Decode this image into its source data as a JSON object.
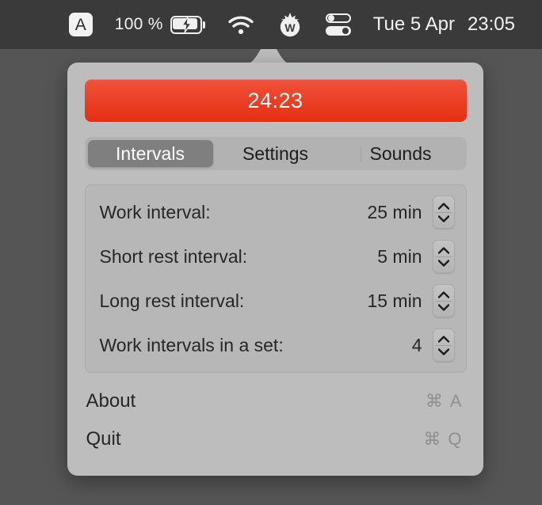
{
  "menubar": {
    "input_source": {
      "name": "input-source-indicator",
      "label": "A"
    },
    "battery": {
      "percent_label": "100 %",
      "icon": "battery-charging-icon",
      "state": "charging"
    },
    "wifi": {
      "icon": "wifi-icon"
    },
    "app_icon": {
      "icon": "tomato-icon",
      "letter": "W"
    },
    "control_center": {
      "icon": "control-center-icon"
    },
    "clock": {
      "date": "Tue 5 Apr",
      "time": "23:05"
    }
  },
  "popover": {
    "timer": {
      "display": "24:23",
      "color": "#e93a20"
    },
    "tabs": [
      {
        "label": "Intervals",
        "active": true
      },
      {
        "label": "Settings",
        "active": false
      },
      {
        "label": "Sounds",
        "active": false
      }
    ],
    "intervals": [
      {
        "label": "Work interval:",
        "value": "25 min"
      },
      {
        "label": "Short rest interval:",
        "value": "5 min"
      },
      {
        "label": "Long rest interval:",
        "value": "15 min"
      },
      {
        "label": "Work intervals in a set:",
        "value": "4"
      }
    ],
    "menu": [
      {
        "label": "About",
        "shortcut_modifier": "⌘",
        "shortcut_key": "A"
      },
      {
        "label": "Quit",
        "shortcut_modifier": "⌘",
        "shortcut_key": "Q"
      }
    ]
  }
}
